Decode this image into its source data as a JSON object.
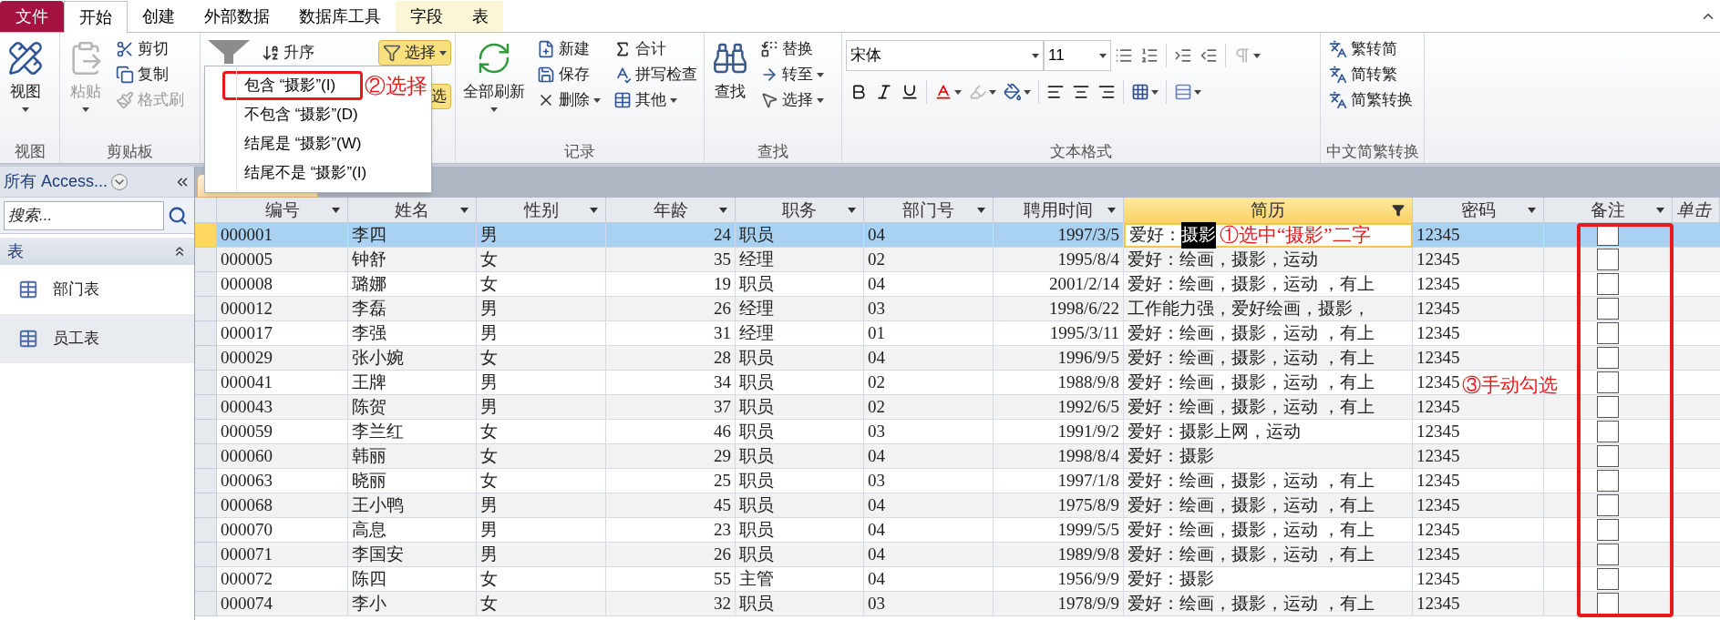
{
  "ribbon_tabs": [
    {
      "label": "文件",
      "kind": "file",
      "selected": false
    },
    {
      "label": "开始",
      "kind": "tab",
      "selected": true
    },
    {
      "label": "创建",
      "kind": "tab",
      "selected": false
    },
    {
      "label": "外部数据",
      "kind": "tab",
      "selected": false
    },
    {
      "label": "数据库工具",
      "kind": "tab",
      "selected": false
    },
    {
      "label": "字段",
      "kind": "context",
      "selected": false
    },
    {
      "label": "表",
      "kind": "context",
      "selected": false
    }
  ],
  "ribbon": {
    "view": {
      "label": "视图",
      "buttons": [
        {
          "label": "视图",
          "disabled": false,
          "dropdown": true
        }
      ]
    },
    "clipboard": {
      "label": "剪贴板",
      "buttons": [
        {
          "label": "粘贴",
          "disabled": true,
          "dropdown": true
        },
        {
          "label": "剪切",
          "disabled": false
        },
        {
          "label": "复制",
          "disabled": false
        },
        {
          "label": "格式刷",
          "disabled": true
        }
      ]
    },
    "sort_filter": {
      "buttons": [
        {
          "label": "升序",
          "active": false,
          "dropdown": false
        },
        {
          "label": "选择",
          "active": true,
          "dropdown": true
        },
        {
          "label": "选",
          "active": true,
          "dropdown": false
        }
      ]
    },
    "records": {
      "label": "记录",
      "buttons": [
        {
          "label": "全部刷新",
          "dropdown": true
        },
        {
          "label": "新建",
          "dropdown": false
        },
        {
          "label": "保存",
          "dropdown": false
        },
        {
          "label": "删除",
          "dropdown": true
        },
        {
          "label": "合计",
          "dropdown": false
        },
        {
          "label": "拼写检查",
          "dropdown": false
        },
        {
          "label": "其他",
          "dropdown": true
        }
      ]
    },
    "find": {
      "label": "查找",
      "buttons": [
        {
          "label": "查找",
          "dropdown": false
        },
        {
          "label": "替换",
          "dropdown": false
        },
        {
          "label": "转至",
          "dropdown": true
        },
        {
          "label": "选择",
          "dropdown": true
        }
      ]
    },
    "text_format": {
      "label": "文本格式",
      "font": "宋体",
      "size": "11"
    },
    "chinese": {
      "label": "中文简繁转换",
      "buttons": [
        {
          "label": "繁转简"
        },
        {
          "label": "简转繁"
        },
        {
          "label": "简繁转换"
        }
      ]
    }
  },
  "filter_menu": {
    "items": [
      {
        "label": "包含 “摄影”(I)",
        "annotated": true
      },
      {
        "label": "不包含 “摄影”(D)",
        "annotated": false
      },
      {
        "label": "结尾是 “摄影”(W)",
        "annotated": false
      },
      {
        "label": "结尾不是 “摄影”(I)",
        "annotated": false
      }
    ]
  },
  "annotations": [
    {
      "kind": "menu",
      "text": "②选择"
    },
    {
      "kind": "cell",
      "text": "①选中“摄影”二字"
    },
    {
      "kind": "column",
      "text": "③手动勾选"
    }
  ],
  "nav": {
    "title": "所有 Access...",
    "search": {
      "placeholder": "搜索..."
    },
    "sections": [
      {
        "label": "表",
        "expanded": true,
        "items": [
          {
            "label": "部门表",
            "selected": false
          },
          {
            "label": "员工表",
            "selected": true
          }
        ]
      }
    ]
  },
  "table": {
    "columns": [
      {
        "label": "编号",
        "kind": "text",
        "selected": false
      },
      {
        "label": "姓名",
        "kind": "text",
        "selected": false
      },
      {
        "label": "性别",
        "kind": "text",
        "selected": false
      },
      {
        "label": "年龄",
        "kind": "number",
        "selected": false
      },
      {
        "label": "职务",
        "kind": "text",
        "selected": false
      },
      {
        "label": "部门号",
        "kind": "text",
        "selected": false
      },
      {
        "label": "聘用时间",
        "kind": "date",
        "selected": false
      },
      {
        "label": "简历",
        "kind": "text",
        "selected": true
      },
      {
        "label": "密码",
        "kind": "text",
        "selected": false
      },
      {
        "label": "备注",
        "kind": "checkbox",
        "selected": false
      },
      {
        "label": "单击",
        "kind": "add",
        "selected": false
      }
    ],
    "rows": [
      {
        "selected": true,
        "checked": false,
        "cells": [
          "000001",
          "李四",
          "男",
          "24",
          "职员",
          "04",
          "1997/3/5",
          {
            "text": "爱好：",
            "selected_text": "摄影"
          },
          "12345"
        ]
      },
      {
        "selected": false,
        "checked": false,
        "cells": [
          "000005",
          "钟舒",
          "女",
          "35",
          "经理",
          "02",
          "1995/8/4",
          "爱好：绘画，摄影，运动",
          "12345"
        ]
      },
      {
        "selected": false,
        "checked": false,
        "cells": [
          "000008",
          "璐娜",
          "女",
          "19",
          "职员",
          "04",
          "2001/2/14",
          "爱好：绘画，摄影，运动 ，有上",
          "12345"
        ]
      },
      {
        "selected": false,
        "checked": false,
        "cells": [
          "000012",
          "李磊",
          "男",
          "26",
          "经理",
          "03",
          "1998/6/22",
          "工作能力强，爱好绘画，摄影，",
          "12345"
        ]
      },
      {
        "selected": false,
        "checked": false,
        "cells": [
          "000017",
          "李强",
          "男",
          "31",
          "经理",
          "01",
          "1995/3/11",
          "爱好：绘画，摄影，运动 ，有上",
          "12345"
        ]
      },
      {
        "selected": false,
        "checked": false,
        "cells": [
          "000029",
          "张小婉",
          "女",
          "28",
          "职员",
          "04",
          "1996/9/5",
          "爱好：绘画，摄影，运动 ，有上",
          "12345"
        ]
      },
      {
        "selected": false,
        "checked": false,
        "cells": [
          "000041",
          "王牌",
          "男",
          "34",
          "职员",
          "02",
          "1988/9/8",
          "爱好：绘画，摄影，运动 ，有上",
          "12345"
        ]
      },
      {
        "selected": false,
        "checked": false,
        "cells": [
          "000043",
          "陈贺",
          "男",
          "37",
          "职员",
          "02",
          "1992/6/5",
          "爱好：绘画，摄影，运动 ，有上",
          "12345"
        ]
      },
      {
        "selected": false,
        "checked": false,
        "cells": [
          "000059",
          "李兰红",
          "女",
          "46",
          "职员",
          "03",
          "1991/9/2",
          "爱好：摄影上网，运动",
          "12345"
        ]
      },
      {
        "selected": false,
        "checked": false,
        "cells": [
          "000060",
          "韩丽",
          "女",
          "29",
          "职员",
          "04",
          "1998/8/4",
          "爱好：摄影",
          "12345"
        ]
      },
      {
        "selected": false,
        "checked": false,
        "cells": [
          "000063",
          "晓丽",
          "女",
          "25",
          "职员",
          "03",
          "1997/1/8",
          "爱好：绘画，摄影，运动 ，有上",
          "12345"
        ]
      },
      {
        "selected": false,
        "checked": false,
        "cells": [
          "000068",
          "王小鸭",
          "男",
          "45",
          "职员",
          "04",
          "1975/8/9",
          "爱好：绘画，摄影，运动 ，有上",
          "12345"
        ]
      },
      {
        "selected": false,
        "checked": false,
        "cells": [
          "000070",
          "高息",
          "男",
          "23",
          "职员",
          "04",
          "1999/5/5",
          "爱好：绘画，摄影，运动 ，有上",
          "12345"
        ]
      },
      {
        "selected": false,
        "checked": false,
        "cells": [
          "000071",
          "李国安",
          "男",
          "26",
          "职员",
          "04",
          "1989/9/8",
          "爱好：绘画，摄影，运动 ，有上",
          "12345"
        ]
      },
      {
        "selected": false,
        "checked": false,
        "cells": [
          "000072",
          "陈四",
          "女",
          "55",
          "主管",
          "04",
          "1956/9/9",
          "爱好：摄影",
          "12345"
        ]
      },
      {
        "selected": false,
        "checked": false,
        "cells": [
          "000074",
          "李小",
          "女",
          "32",
          "职员",
          "03",
          "1978/9/9",
          "爱好：绘画，摄影，运动 ，有上",
          "12345"
        ]
      }
    ]
  }
}
